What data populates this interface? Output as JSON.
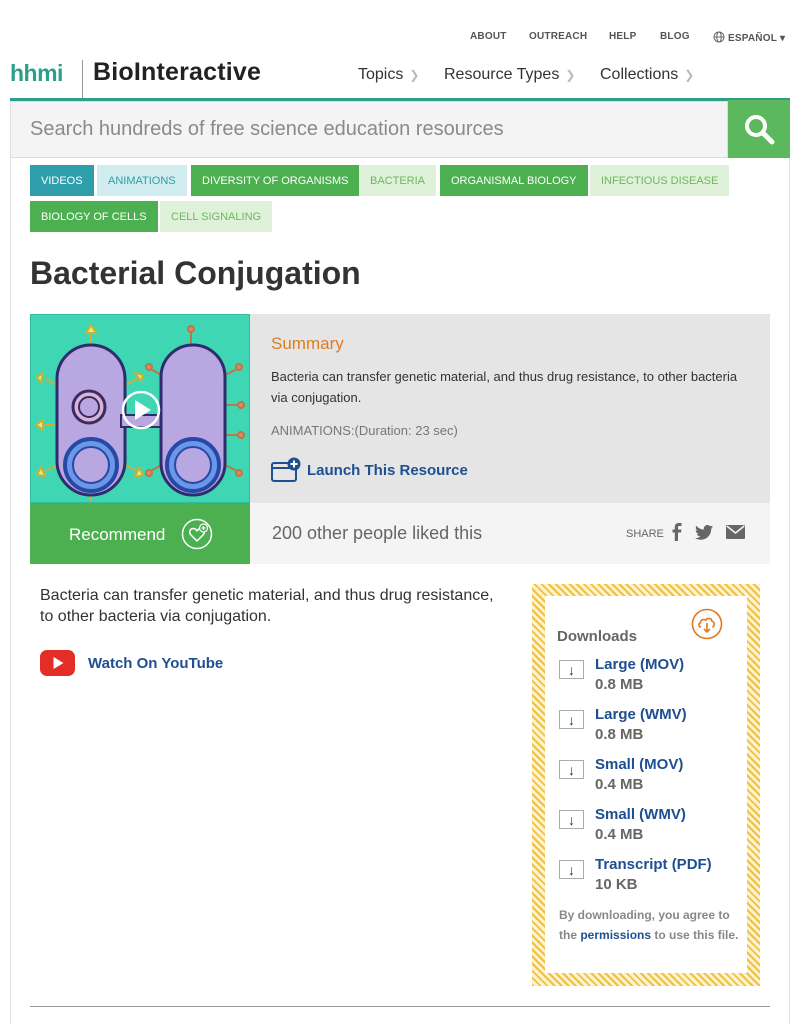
{
  "util_nav": {
    "items": [
      "ABOUT",
      "OUTREACH",
      "HELP",
      "BLOG"
    ],
    "language": "ESPAÑOL"
  },
  "brand": {
    "hhmi": "hhmi",
    "name": "BioInteractive"
  },
  "main_nav": [
    "Topics",
    "Resource Types",
    "Collections"
  ],
  "search": {
    "placeholder": "Search hundreds of free science education resources"
  },
  "tags": [
    "VIDEOS",
    "ANIMATIONS",
    "DIVERSITY OF ORGANISMS",
    "BACTERIA",
    "ORGANISMAL BIOLOGY",
    "INFECTIOUS DISEASE",
    "BIOLOGY OF CELLS",
    "CELL SIGNALING"
  ],
  "page": {
    "title": "Bacterial Conjugation"
  },
  "summary": {
    "heading": "Summary",
    "text": "Bacteria can transfer genetic material, and thus drug resistance, to other bacteria via conjugation.",
    "meta": "ANIMATIONS:(Duration: 23 sec)",
    "launch_label": "Launch This Resource"
  },
  "social": {
    "recommend_label": "Recommend",
    "like_count": "200 other people liked this",
    "share_label": "SHARE"
  },
  "body": {
    "description": "Bacteria can transfer genetic material, and thus drug resistance, to other bacteria via conjugation.",
    "youtube_label": "Watch On YouTube"
  },
  "downloads": {
    "heading": "Downloads",
    "items": [
      {
        "name": "Large (MOV)",
        "size": "0.8 MB"
      },
      {
        "name": "Large (WMV)",
        "size": "0.8 MB"
      },
      {
        "name": "Small (MOV)",
        "size": "0.4 MB"
      },
      {
        "name": "Small (WMV)",
        "size": "0.4 MB"
      },
      {
        "name": "Transcript (PDF)",
        "size": "10 KB"
      }
    ],
    "terms_pre": "By downloading, you agree to the",
    "terms_link": "permissions",
    "terms_post": "to use this file."
  },
  "colors": {
    "brand_teal": "#2e9e8c",
    "accent_green": "#4caf50",
    "link_blue": "#1d4f91",
    "accent_orange": "#e07b1f",
    "youtube_red": "#e52d27"
  },
  "icons": [
    "globe-icon",
    "chevron-down-icon",
    "search-icon",
    "play-icon",
    "launch-icon",
    "heart-plus-icon",
    "facebook-icon",
    "twitter-icon",
    "email-icon",
    "youtube-icon",
    "cloud-download-icon",
    "download-arrow-icon"
  ]
}
